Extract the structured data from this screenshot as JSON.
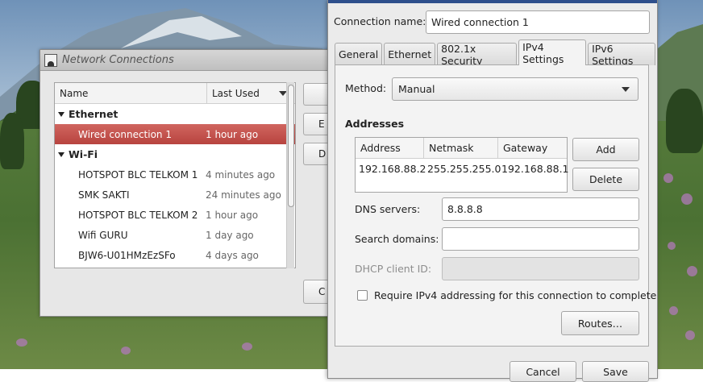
{
  "network_connections": {
    "title": "Network Connections",
    "columns": {
      "name": "Name",
      "last_used": "Last Used"
    },
    "groups": [
      {
        "label": "Ethernet",
        "items": [
          {
            "name": "Wired connection 1",
            "last_used": "1 hour ago",
            "selected": true
          }
        ]
      },
      {
        "label": "Wi-Fi",
        "items": [
          {
            "name": "HOTSPOT BLC TELKOM 1",
            "last_used": "4 minutes ago"
          },
          {
            "name": "SMK SAKTI",
            "last_used": "24 minutes ago"
          },
          {
            "name": "HOTSPOT BLC TELKOM 2",
            "last_used": "1 hour ago"
          },
          {
            "name": "Wifi GURU",
            "last_used": "1 day ago"
          },
          {
            "name": "BJW6-U01HMzEzSFo",
            "last_used": "4 days ago"
          }
        ]
      }
    ],
    "side_buttons": [
      "",
      "E",
      "D"
    ],
    "bottom_button": "C"
  },
  "editor": {
    "connection_name_label": "Connection name:",
    "connection_name": "Wired connection 1",
    "tabs": [
      "General",
      "Ethernet",
      "802.1x Security",
      "IPv4 Settings",
      "IPv6 Settings"
    ],
    "active_tab": "IPv4 Settings",
    "method_label": "Method:",
    "method": "Manual",
    "addresses_label": "Addresses",
    "address_columns": [
      "Address",
      "Netmask",
      "Gateway"
    ],
    "addresses": [
      {
        "address": "192.168.88.2",
        "netmask": "255.255.255.0",
        "gateway": "192.168.88.1"
      }
    ],
    "add_button": "Add",
    "delete_button": "Delete",
    "dns_label": "DNS servers:",
    "dns_value": "8.8.8.8",
    "search_domains_label": "Search domains:",
    "search_domains_value": "",
    "dhcp_client_id_label": "DHCP client ID:",
    "dhcp_client_id_value": "",
    "require_ipv4_label": "Require IPv4 addressing for this connection to complete",
    "require_ipv4_checked": false,
    "routes_button": "Routes…",
    "footer_buttons": [
      "Cancel",
      "Save"
    ]
  }
}
